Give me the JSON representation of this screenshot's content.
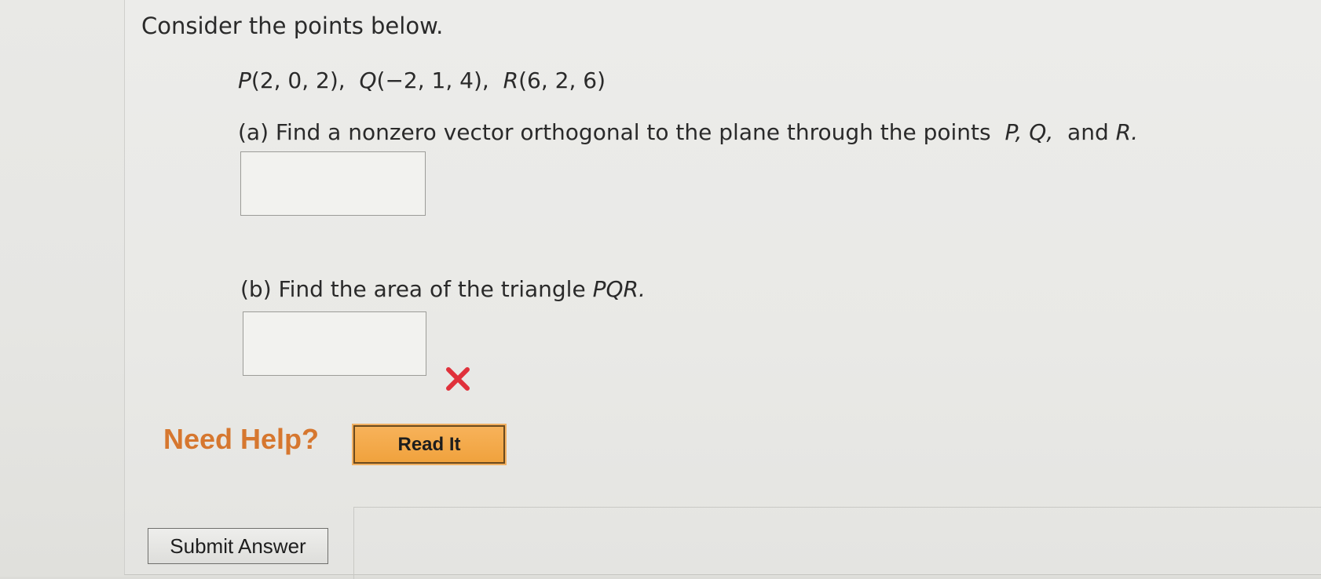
{
  "question": {
    "prompt": "Consider the points below.",
    "points": [
      {
        "name": "P",
        "coords": "(2, 0, 2),"
      },
      {
        "name": "Q",
        "coords": "(−2, 1, 4),"
      },
      {
        "name": "R",
        "coords": "(6, 2, 6)"
      }
    ],
    "part_a": {
      "label": "(a) Find a nonzero vector orthogonal to the plane through the points",
      "p": "P,",
      "q": "Q,",
      "and": "and",
      "r": "R.",
      "answer": ""
    },
    "part_b": {
      "label": "(b) Find the area of the triangle",
      "triangle": "PQR.",
      "answer": "",
      "status": "incorrect"
    }
  },
  "help": {
    "label": "Need Help?",
    "read_it": "Read It"
  },
  "actions": {
    "submit": "Submit Answer"
  },
  "colors": {
    "need_help": "#d6772f",
    "read_it_bg": "#f0a23d",
    "incorrect_mark": "#e0313b"
  }
}
